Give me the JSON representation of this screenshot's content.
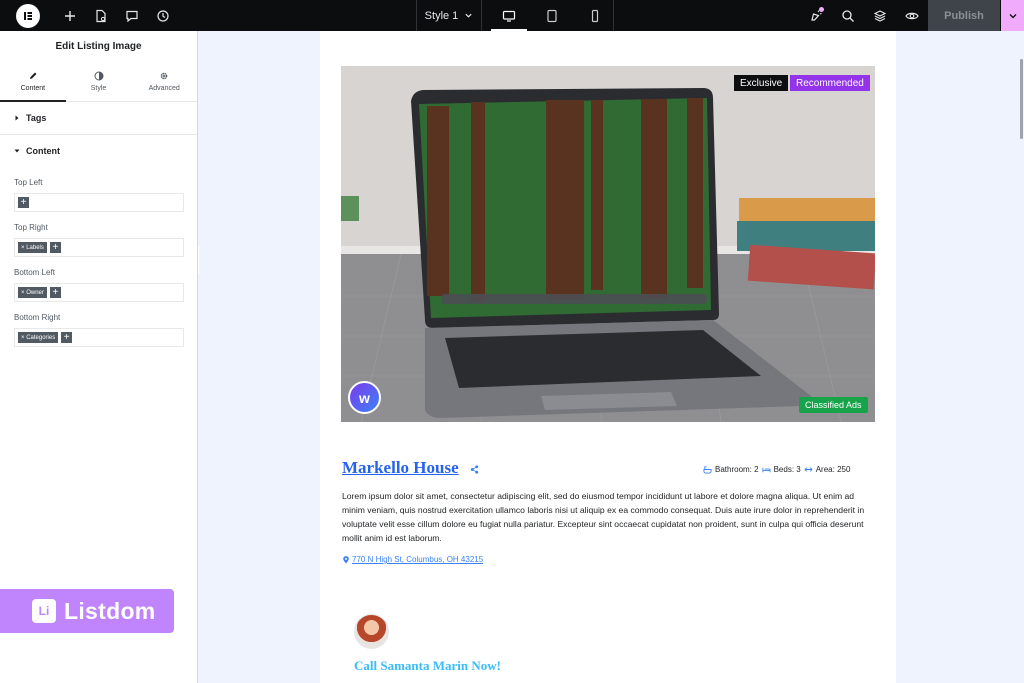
{
  "topbar": {
    "style_label": "Style 1",
    "publish_label": "Publish"
  },
  "panel": {
    "title": "Edit Listing Image",
    "tabs": [
      {
        "label": "Content"
      },
      {
        "label": "Style"
      },
      {
        "label": "Advanced"
      }
    ],
    "sections": {
      "tags": "Tags",
      "content": "Content"
    },
    "fields": [
      {
        "label": "Top Left",
        "chip": ""
      },
      {
        "label": "Top Right",
        "chip": "Labels"
      },
      {
        "label": "Bottom Left",
        "chip": "Owner"
      },
      {
        "label": "Bottom Right",
        "chip": "Categories"
      }
    ],
    "chip_prefix": "×",
    "brand": "Listdom",
    "brand_mark": "Li"
  },
  "listing": {
    "badges": {
      "exclusive": "Exclusive",
      "recommended": "Recommended",
      "category": "Classified Ads"
    },
    "owner_logo_letter": "w",
    "title": "Markello House",
    "stats": {
      "bathroom": "Bathroom: 2",
      "beds": "Beds: 3",
      "area": "Area: 250"
    },
    "description": "Lorem ipsum dolor sit amet, consectetur adipiscing elit, sed do eiusmod tempor incididunt ut labore et dolore magna aliqua. Ut enim ad minim veniam, quis nostrud exercitation ullamco laboris nisi ut aliquip ex ea commodo consequat. Duis aute irure dolor in reprehenderit in voluptate velit esse cillum dolore eu fugiat nulla pariatur. Excepteur sint occaecat cupidatat non proident, sunt in culpa qui officia deserunt mollit anim id est laborum.",
    "address": "770 N High St, Columbus, OH 43215",
    "call_text": "Call Samanta Marin Now!"
  },
  "colors": {
    "accent": "#f0abfc",
    "brand": "#c084fc",
    "link": "#2563eb",
    "category_badge": "#16a34a",
    "recommended_badge": "#9333ea"
  }
}
